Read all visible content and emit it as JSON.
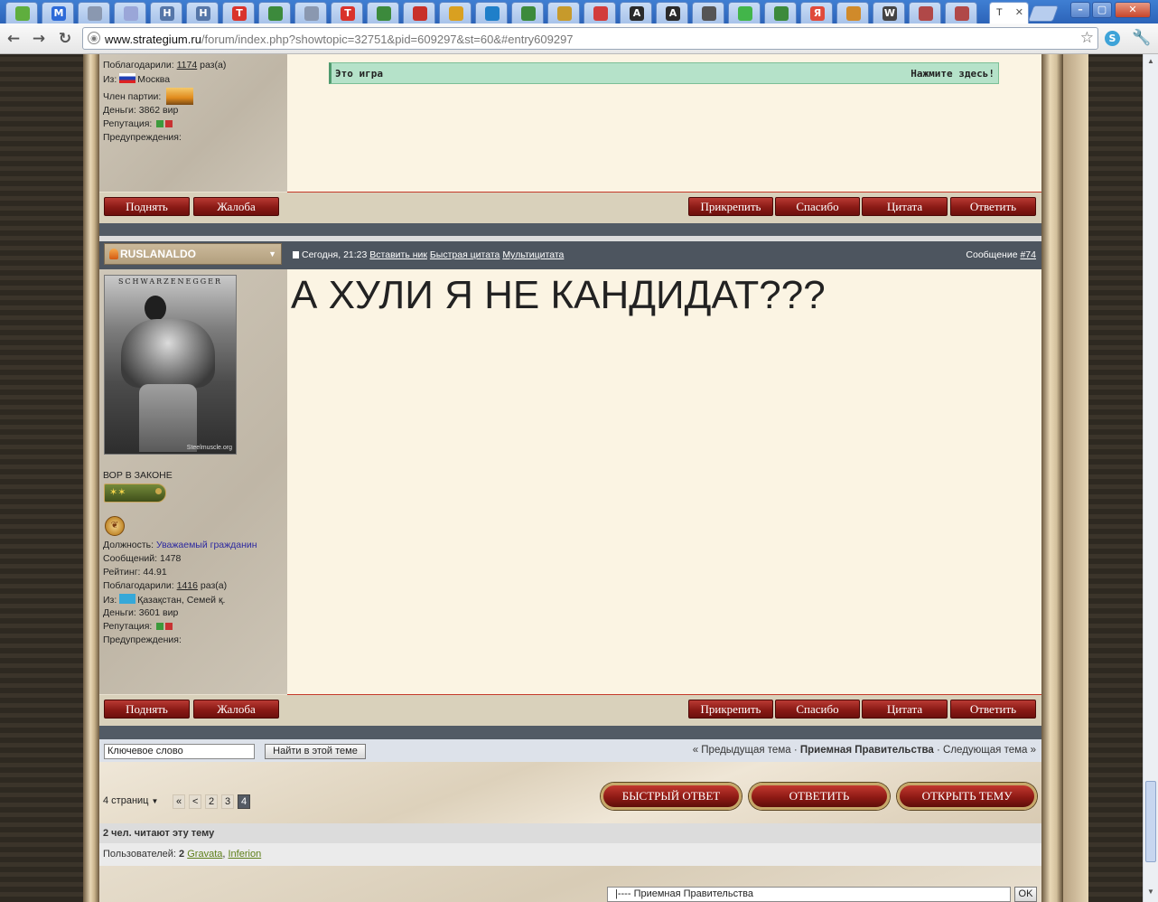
{
  "browser": {
    "tabs": [
      {
        "icon": "puzzle-icon",
        "letter": "",
        "color": "#5fae3e"
      },
      {
        "icon": "m-icon",
        "letter": "M",
        "color": "#2d6ad8"
      },
      {
        "icon": "globe-icon",
        "letter": "",
        "color": "#8a98b0"
      },
      {
        "icon": "grid-icon",
        "letter": "",
        "color": "#9aa6d8"
      },
      {
        "icon": "n-icon",
        "letter": "H",
        "color": "#5576a8"
      },
      {
        "icon": "n-icon",
        "letter": "H",
        "color": "#5576a8"
      },
      {
        "icon": "t-icon",
        "letter": "T",
        "color": "#d9332b"
      },
      {
        "icon": "google-icon",
        "letter": "",
        "color": "#3c8a3c"
      },
      {
        "icon": "globe-icon",
        "letter": "",
        "color": "#8a98b0"
      },
      {
        "icon": "t-icon",
        "letter": "T",
        "color": "#d9332b"
      },
      {
        "icon": "google-icon",
        "letter": "",
        "color": "#3c8a3c"
      },
      {
        "icon": "triangle-icon",
        "letter": "",
        "color": "#c8302a"
      },
      {
        "icon": "tools-icon",
        "letter": "",
        "color": "#d9a020"
      },
      {
        "icon": "drupal-icon",
        "letter": "",
        "color": "#1f7fc9"
      },
      {
        "icon": "google-icon",
        "letter": "",
        "color": "#3c8a3c"
      },
      {
        "icon": "owl-icon",
        "letter": "",
        "color": "#c79a2b"
      },
      {
        "icon": "stripes-icon",
        "letter": "",
        "color": "#d23c3c"
      },
      {
        "icon": "a-icon",
        "letter": "A",
        "color": "#2a2a2a"
      },
      {
        "icon": "a-icon",
        "letter": "A",
        "color": "#2a2a2a"
      },
      {
        "icon": "monitor-icon",
        "letter": "",
        "color": "#555555"
      },
      {
        "icon": "check-icon",
        "letter": "",
        "color": "#42b54a"
      },
      {
        "icon": "google-icon",
        "letter": "",
        "color": "#3c8a3c"
      },
      {
        "icon": "yandex-icon",
        "letter": "Я",
        "color": "#e04a3a"
      },
      {
        "icon": "picture-icon",
        "letter": "",
        "color": "#d08a2a"
      },
      {
        "icon": "wikipedia-icon",
        "letter": "W",
        "color": "#444444"
      },
      {
        "icon": "avatar-icon",
        "letter": "",
        "color": "#b04848"
      },
      {
        "icon": "avatar-icon",
        "letter": "",
        "color": "#b04848"
      }
    ],
    "active_tab_title": "T",
    "url_host": "www.strategium.ru",
    "url_path": "/forum/index.php?showtopic=32751&pid=609297&st=60&#entry609297"
  },
  "prev_post": {
    "thanks_label": "Поблагодарили:",
    "thanks_count": "1174",
    "thanks_suffix": "раз(а)",
    "from_label": "Из:",
    "from_value": "Москва",
    "party_label": "Член партии:",
    "money": "Деньги: 3862 вир",
    "reputation_label": "Репутация:",
    "warnings_label": "Предупреждения:",
    "spoiler_label": "Это игра",
    "spoiler_action": "Нажмите здесь!"
  },
  "actions": {
    "up": "Поднять",
    "report": "Жалоба",
    "pin": "Прикрепить",
    "thanks": "Спасибо",
    "quote": "Цитата",
    "reply": "Ответить"
  },
  "post": {
    "author": "RUSLANALDO",
    "date": "Сегодня, 21:23",
    "insert_nick": "Вставить ник",
    "quick_quote": "Быстрая цитата",
    "multi_quote": "Мультицитата",
    "message_label": "Сообщение",
    "message_number": "#74",
    "body": "А ХУЛИ Я НЕ КАНДИДАТ???",
    "avatar_text": "SCHWARZENEGGER",
    "avatar_watermark": "Steelmuscle.org",
    "title": "ВОР В ЗАКОНЕ",
    "position_label": "Должность:",
    "position_value": "Уважаемый гражданин",
    "messages": "Сообщений: 1478",
    "rating": "Рейтинг: 44.91",
    "thanks_label": "Поблагодарили:",
    "thanks_count": "1416",
    "thanks_suffix": "раз(а)",
    "from_label": "Из:",
    "from_value": "Қазақстан, Семей қ.",
    "money": "Деньги: 3601 вир",
    "reputation_label": "Репутация:",
    "warnings_label": "Предупреждения:"
  },
  "search": {
    "keyword_value": "Ключевое слово",
    "find_button": "Найти в этой теме"
  },
  "topic_nav": {
    "prev": "« Предыдущая тема",
    "sep1": " · ",
    "forum": "Приемная Правительства",
    "sep2": " · ",
    "next": "Следующая тема »"
  },
  "pagination": {
    "label": "4 страниц",
    "first": "«",
    "prev": "<",
    "pages": [
      "2",
      "3"
    ],
    "current": "4"
  },
  "big_buttons": {
    "quick_reply": "БЫСТРЫЙ ОТВЕТ",
    "reply": "ОТВЕТИТЬ",
    "new_topic": "ОТКРЫТЬ ТЕМУ"
  },
  "readers": {
    "title": "2 чел. читают эту тему",
    "users_label": "Пользователей:",
    "users_count": "2",
    "user1": "Gravata",
    "user2": "Inferion"
  },
  "forum_jump": {
    "selected": "|---- Приемная Правительства",
    "ok": "OK"
  },
  "colors": {
    "button_red": "#8a1a15",
    "header_gray": "#4d555f",
    "spoiler_green": "#b5e2c9",
    "link_green": "#5d7e18",
    "position_blue": "#2e2aa0"
  }
}
